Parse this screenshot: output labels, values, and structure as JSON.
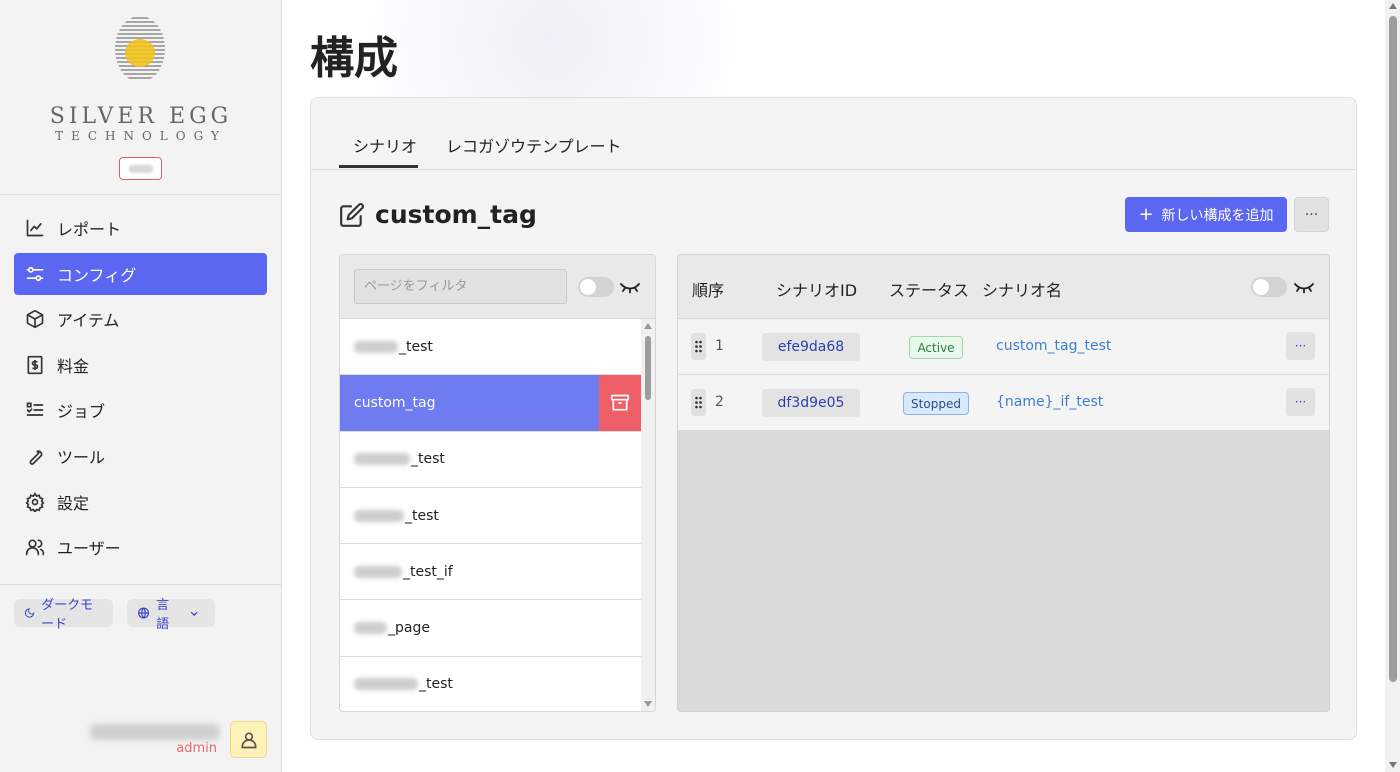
{
  "sidebar": {
    "brand_line1": "SILVER EGG",
    "brand_line2": "TECHNOLOGY",
    "nav": [
      {
        "label": "レポート",
        "icon": "chart-line-icon"
      },
      {
        "label": "コンフィグ",
        "icon": "sliders-icon",
        "active": true
      },
      {
        "label": "アイテム",
        "icon": "cube-icon"
      },
      {
        "label": "料金",
        "icon": "dollar-doc-icon"
      },
      {
        "label": "ジョブ",
        "icon": "list-checks-icon"
      },
      {
        "label": "ツール",
        "icon": "wrench-icon"
      },
      {
        "label": "設定",
        "icon": "gear-icon"
      },
      {
        "label": "ユーザー",
        "icon": "users-icon"
      }
    ],
    "dark_mode_label": "ダークモード",
    "language_label": "言語",
    "user_role": "admin"
  },
  "page": {
    "title": "構成",
    "tabs": [
      {
        "label": "シナリオ",
        "active": true
      },
      {
        "label": "レコガゾウテンプレート"
      }
    ],
    "section_title": "custom_tag",
    "add_button_label": "新しい構成を追加",
    "more_label": "···"
  },
  "page_list": {
    "filter_placeholder": "ページをフィルタ",
    "items": [
      {
        "suffix": "_test"
      },
      {
        "label": "custom_tag",
        "selected": true
      },
      {
        "suffix": "_test"
      },
      {
        "suffix": "_test"
      },
      {
        "suffix": "_test_if"
      },
      {
        "suffix": "_page"
      },
      {
        "suffix": "_test"
      }
    ]
  },
  "scenario_table": {
    "headers": [
      "順序",
      "シナリオID",
      "ステータス",
      "シナリオ名"
    ],
    "rows": [
      {
        "order": "1",
        "id": "efe9da68",
        "status": "Active",
        "name": "custom_tag_test"
      },
      {
        "order": "2",
        "id": "df3d9e05",
        "status": "Stopped",
        "name": "{name}_if_test"
      }
    ],
    "row_more_label": "···"
  },
  "colors": {
    "accent": "#5b67f0",
    "selected_row": "#6f7bf0",
    "archive": "#ee5f67",
    "link": "#3b7fd0"
  }
}
